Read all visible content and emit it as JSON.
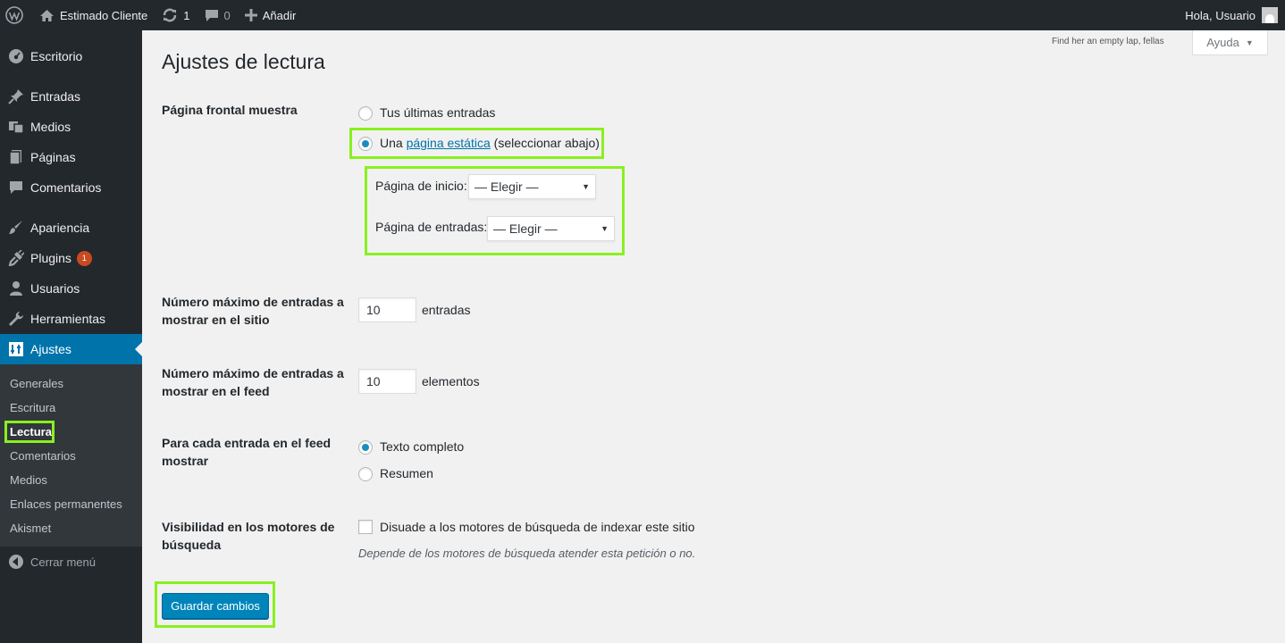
{
  "adminbar": {
    "site_name": "Estimado Cliente",
    "updates_count": "1",
    "comments_count": "0",
    "add_new": "Añadir",
    "greeting": "Hola, Usuario"
  },
  "sidebar": {
    "items": [
      {
        "label": "Escritorio",
        "icon": "dashboard-icon"
      },
      {
        "label": "Entradas",
        "icon": "pin-icon"
      },
      {
        "label": "Medios",
        "icon": "media-icon"
      },
      {
        "label": "Páginas",
        "icon": "pages-icon"
      },
      {
        "label": "Comentarios",
        "icon": "comments-icon"
      },
      {
        "label": "Apariencia",
        "icon": "brush-icon"
      },
      {
        "label": "Plugins",
        "icon": "plugin-icon",
        "badge": "1"
      },
      {
        "label": "Usuarios",
        "icon": "users-icon"
      },
      {
        "label": "Herramientas",
        "icon": "wrench-icon"
      },
      {
        "label": "Ajustes",
        "icon": "settings-icon"
      }
    ],
    "submenu": [
      "Generales",
      "Escritura",
      "Lectura",
      "Comentarios",
      "Medios",
      "Enlaces permanentes",
      "Akismet"
    ],
    "collapse": "Cerrar menú"
  },
  "help": {
    "tab": "Ayuda",
    "notice": "Find her an empty lap, fellas"
  },
  "page": {
    "title": "Ajustes de lectura",
    "front_page": {
      "label": "Página frontal muestra",
      "option_latest": "Tus últimas entradas",
      "option_static_prefix": "Una",
      "option_static_link": "página estática",
      "option_static_suffix": "(seleccionar abajo)",
      "home_label": "Página de inicio:",
      "home_value": "— Elegir —",
      "posts_label": "Página de entradas:",
      "posts_value": "— Elegir —"
    },
    "posts_per_page": {
      "label": "Número máximo de entradas a mostrar en el sitio",
      "value": "10",
      "unit": "entradas"
    },
    "posts_per_rss": {
      "label": "Número máximo de entradas a mostrar en el feed",
      "value": "10",
      "unit": "elementos"
    },
    "rss_use_excerpt": {
      "label": "Para cada entrada en el feed mostrar",
      "option_full": "Texto completo",
      "option_summary": "Resumen"
    },
    "blog_public": {
      "label": "Visibilidad en los motores de búsqueda",
      "checkbox_label": "Disuade a los motores de búsqueda de indexar este sitio",
      "description": "Depende de los motores de búsqueda atender esta petición o no."
    },
    "submit": "Guardar cambios"
  },
  "colors": {
    "accent": "#0073aa",
    "highlight": "#8af01f",
    "sidebar": "#23282d",
    "badge": "#ca4a1f"
  }
}
